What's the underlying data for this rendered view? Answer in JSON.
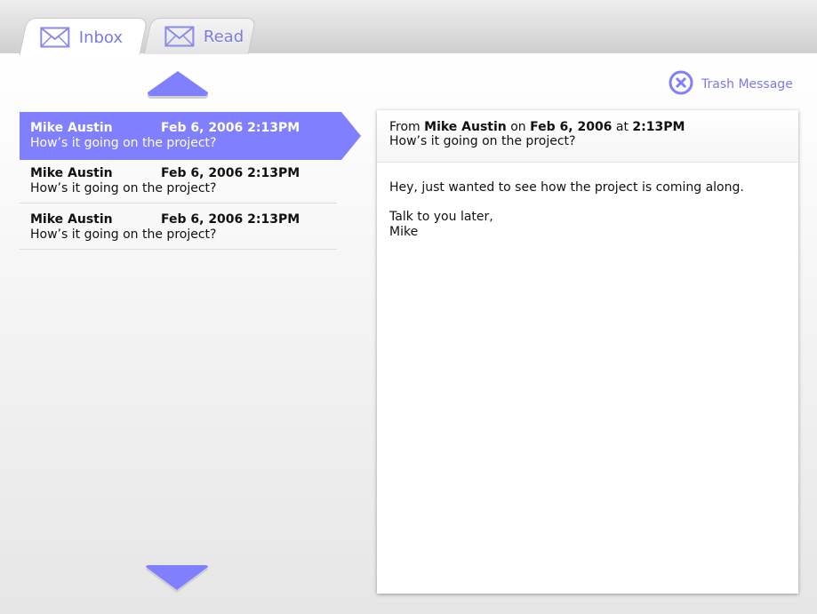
{
  "tabs": [
    {
      "label": "Inbox",
      "icon": "envelope-icon",
      "active": true
    },
    {
      "label": "Read",
      "icon": "envelope-icon",
      "active": false
    }
  ],
  "toolbar": {
    "trash_label": "Trash Message",
    "trash_icon": "close-circle-icon"
  },
  "messages": [
    {
      "sender": "Mike Austin",
      "date": "Feb 6, 2006 2:13PM",
      "subject": "How’s it going on the project?",
      "selected": true
    },
    {
      "sender": "Mike Austin",
      "date": "Feb 6, 2006 2:13PM",
      "subject": "How’s it going on the project?",
      "selected": false
    },
    {
      "sender": "Mike Austin",
      "date": "Feb 6, 2006 2:13PM",
      "subject": "How’s it going on the project?",
      "selected": false
    }
  ],
  "reader": {
    "from_prefix": "From",
    "sender": "Mike Austin",
    "on_word": "on",
    "date": "Feb 6, 2006",
    "at_word": "at",
    "time": "2:13PM",
    "subject": "How’s it going on the project?",
    "body_line1": "Hey, just wanted to see how the project is coming along.",
    "body_line2": "Talk to you later,",
    "body_line3": "Mike"
  },
  "colors": {
    "accent": "#8080ff",
    "accent_text": "#7a7ae6"
  }
}
